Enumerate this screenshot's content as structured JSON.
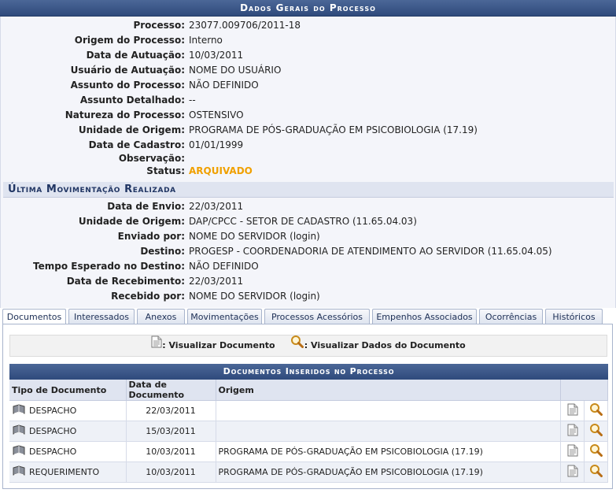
{
  "header": {
    "title": "Dados Gerais do Processo"
  },
  "general": [
    {
      "label": "Processo:",
      "value": "23077.009706/2011-18"
    },
    {
      "label": "Origem do Processo:",
      "value": "Interno"
    },
    {
      "label": "Data de Autuação:",
      "value": "10/03/2011"
    },
    {
      "label": "Usuário de Autuação:",
      "value": "NOME DO USUÁRIO"
    },
    {
      "label": "Assunto do Processo:",
      "value": "NÃO DEFINIDO"
    },
    {
      "label": "Assunto Detalhado:",
      "value": "--"
    },
    {
      "label": "Natureza do Processo:",
      "value": "OSTENSIVO"
    },
    {
      "label": "Unidade de Origem:",
      "value": "PROGRAMA DE PÓS-GRADUAÇÃO EM PSICOBIOLOGIA (17.19)"
    },
    {
      "label": "Data de Cadastro:",
      "value": "01/01/1999"
    },
    {
      "label": "Observação:",
      "value": ""
    },
    {
      "label": "Status:",
      "value": "ARQUIVADO"
    }
  ],
  "last_movement": {
    "title": "Última Movimentação Realizada",
    "fields": [
      {
        "label": "Data de Envio:",
        "value": "22/03/2011"
      },
      {
        "label": "Unidade de Origem:",
        "value": "DAP/CPCC - SETOR DE CADASTRO (11.65.04.03)"
      },
      {
        "label": "Enviado por:",
        "value": "NOME DO SERVIDOR (login)"
      },
      {
        "label": "Destino:",
        "value": "PROGESP - COORDENADORIA DE ATENDIMENTO AO SERVIDOR (11.65.04.05)"
      },
      {
        "label": "Tempo Esperado no Destino:",
        "value": "NÃO DEFINIDO"
      },
      {
        "label": "Data de Recebimento:",
        "value": "22/03/2011"
      },
      {
        "label": "Recebido por:",
        "value": "NOME DO SERVIDOR (login)"
      }
    ]
  },
  "tabs": [
    "Documentos",
    "Interessados",
    "Anexos",
    "Movimentações",
    "Processos Acessórios",
    "Empenhos Associados",
    "Ocorrências",
    "Históricos"
  ],
  "legend": {
    "view_document": ": Visualizar Documento",
    "view_data": ": Visualizar Dados do Documento"
  },
  "documents": {
    "title": "Documentos Inseridos no Processo",
    "columns": [
      "Tipo de Documento",
      "Data de Documento",
      "Origem"
    ],
    "rows": [
      {
        "type": "DESPACHO",
        "date": "22/03/2011",
        "origin": ""
      },
      {
        "type": "DESPACHO",
        "date": "15/03/2011",
        "origin": ""
      },
      {
        "type": "DESPACHO",
        "date": "10/03/2011",
        "origin": "PROGRAMA DE PÓS-GRADUAÇÃO EM PSICOBIOLOGIA (17.19)"
      },
      {
        "type": "REQUERIMENTO",
        "date": "10/03/2011",
        "origin": "PROGRAMA DE PÓS-GRADUAÇÃO EM PSICOBIOLOGIA (17.19)"
      }
    ]
  },
  "colors": {
    "header": "#2f4a7c",
    "status": "#f0a000",
    "subheader": "#dfe4f0"
  }
}
